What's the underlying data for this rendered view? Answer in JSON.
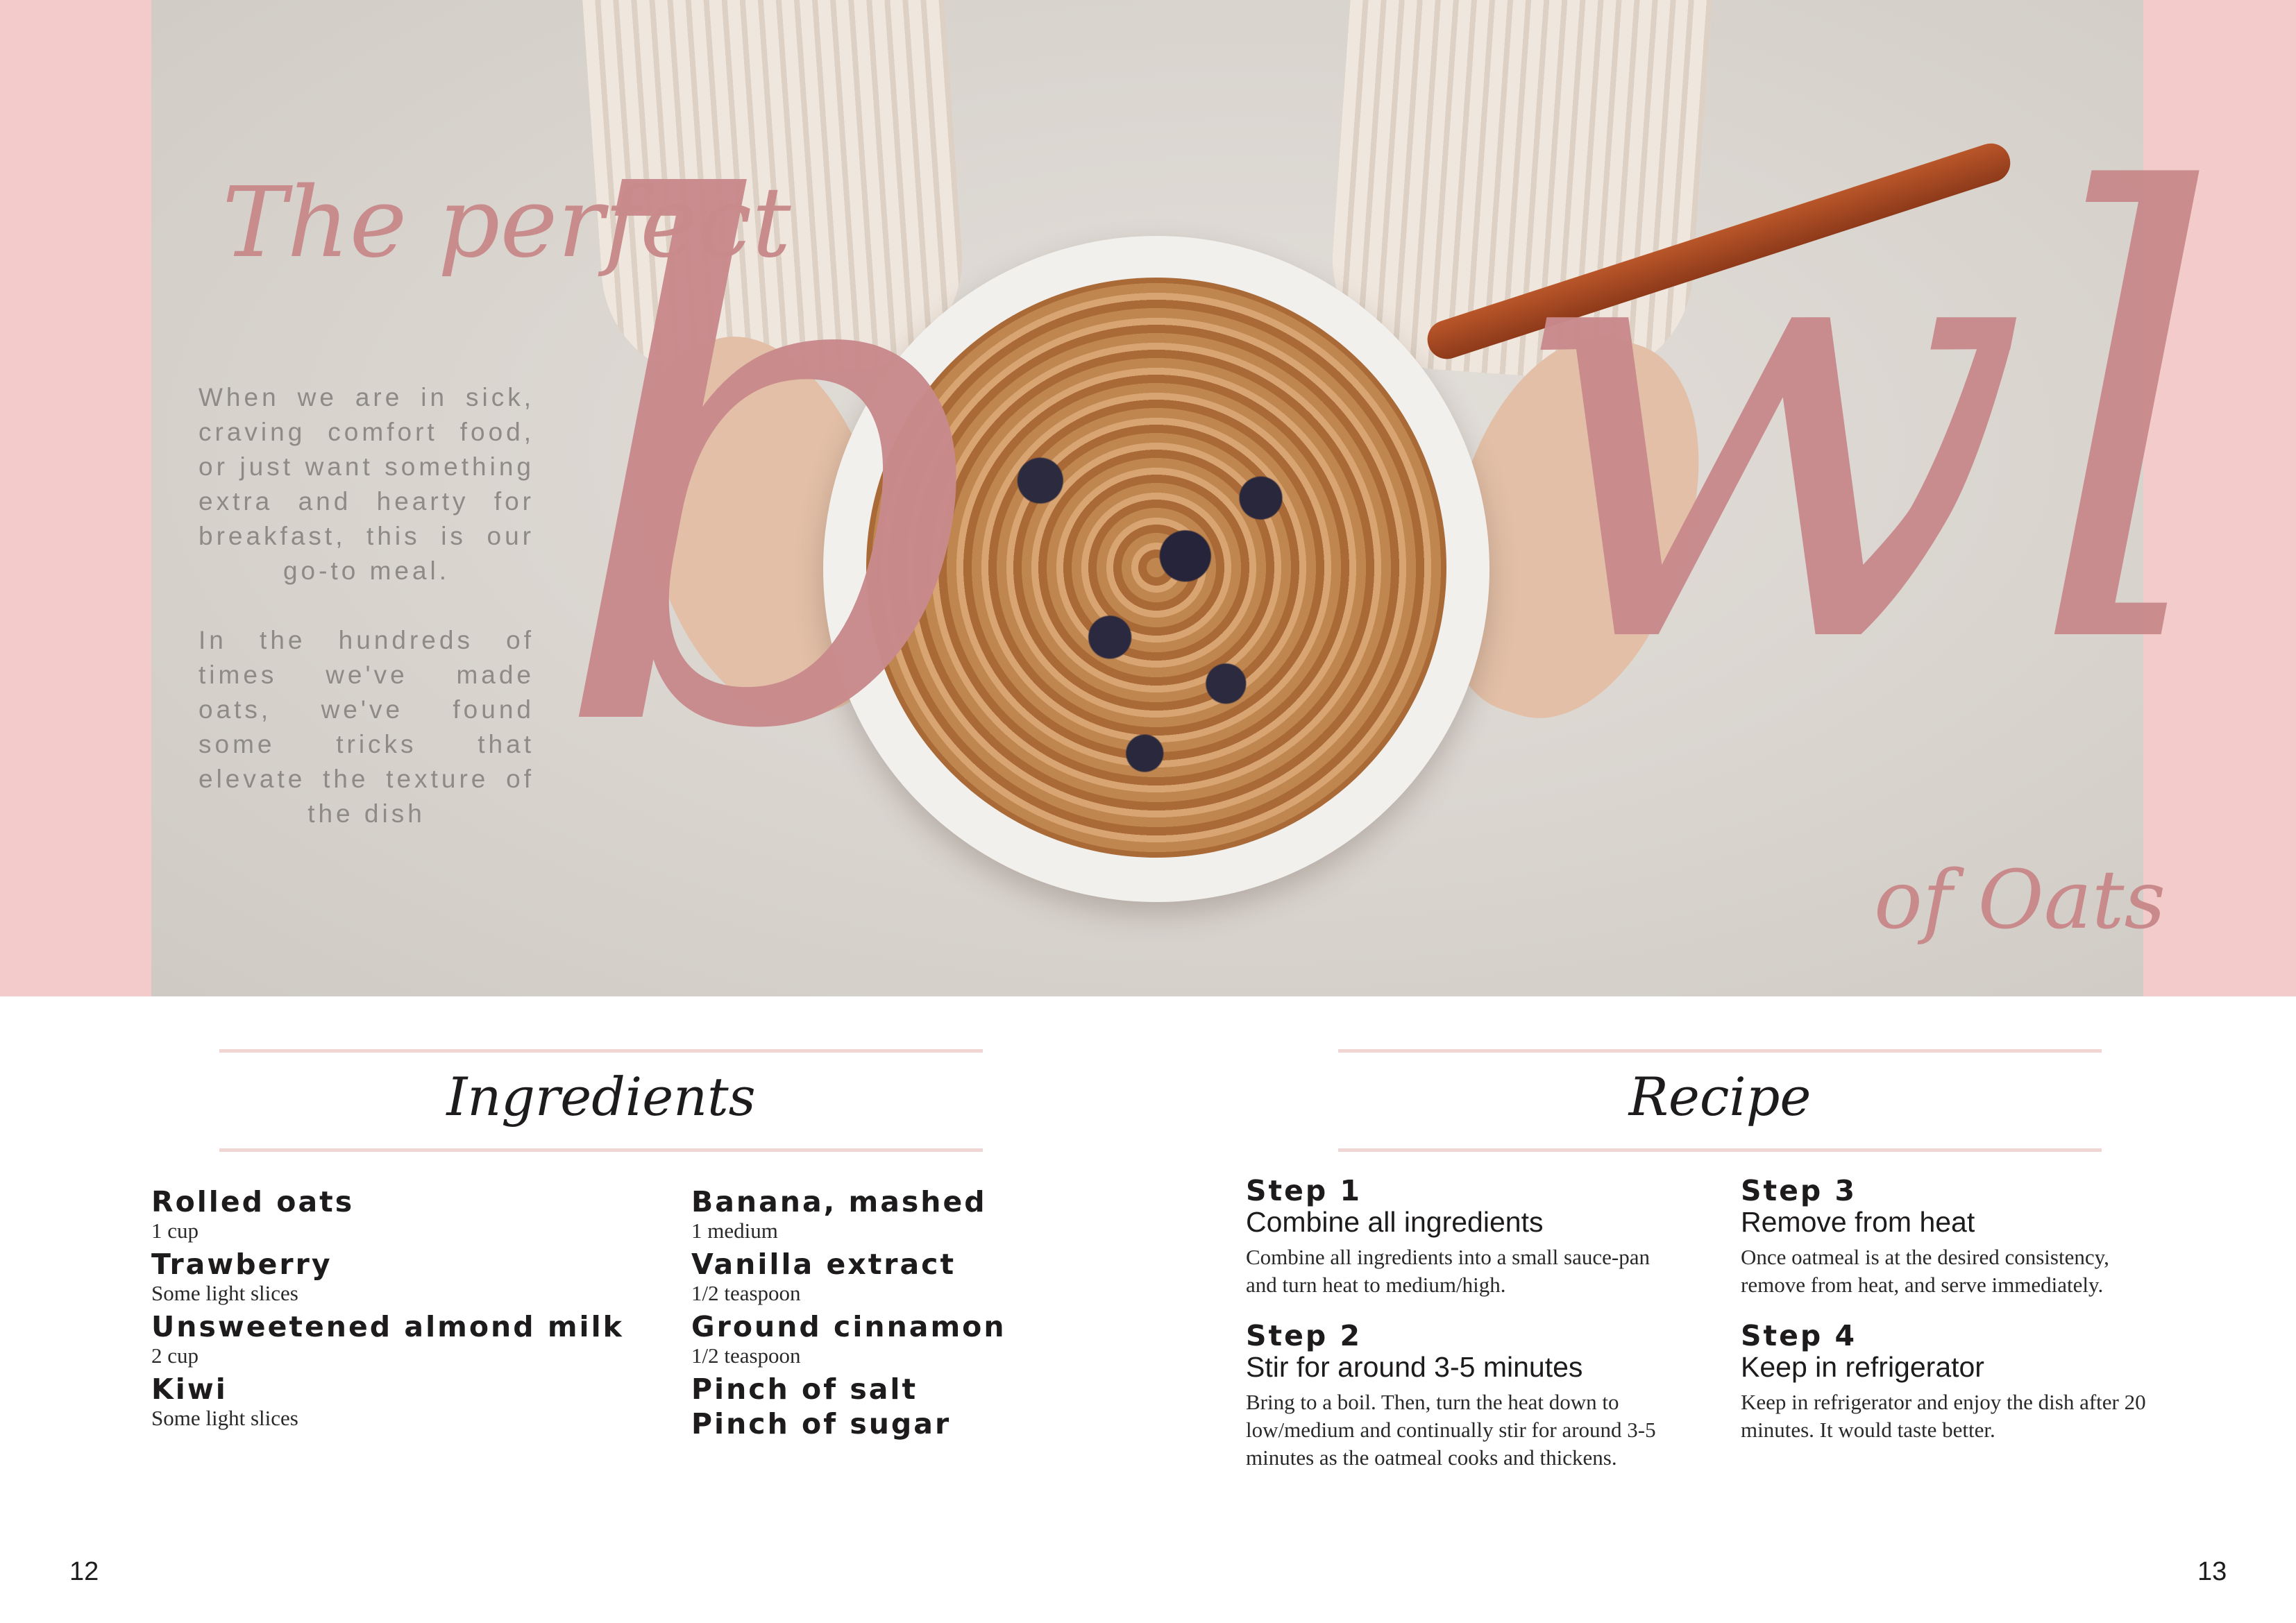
{
  "hero": {
    "title_top": "The perfect",
    "title_big_left": "b",
    "title_big_right": "wl",
    "title_bottom": "of Oats",
    "intro_paragraph_1": "When we are in sick, craving comfort food, or just want something extra and hearty for breakfast, this is our go-to meal.",
    "intro_paragraph_2": "In the hundreds of times we've made oats, we've found some tricks that elevate the texture of the dish"
  },
  "ingredients": {
    "heading": "Ingredients",
    "column_1": [
      {
        "name": "Rolled oats",
        "amount": "1 cup"
      },
      {
        "name": "Trawberry",
        "amount": "Some light slices"
      },
      {
        "name": "Unsweetened almond milk",
        "amount": "2 cup"
      },
      {
        "name": "Kiwi",
        "amount": "Some light slices"
      }
    ],
    "column_2": [
      {
        "name": "Banana, mashed",
        "amount": "1 medium"
      },
      {
        "name": "Vanilla extract",
        "amount": "1/2 teaspoon"
      },
      {
        "name": "Ground cinnamon",
        "amount": "1/2 teaspoon"
      },
      {
        "name": "Pinch of salt",
        "amount": ""
      },
      {
        "name": "Pinch of sugar",
        "amount": ""
      }
    ]
  },
  "recipe": {
    "heading": "Recipe",
    "steps": [
      {
        "num": "Step 1",
        "title": "Combine all ingredients",
        "body": "Combine all ingredients into a small sauce-pan and turn heat to medium/high."
      },
      {
        "num": "Step 2",
        "title": "Stir for around 3-5 minutes",
        "body": "Bring to a boil. Then, turn the heat down to low/medium and continually stir for around 3-5 minutes as the oatmeal cooks and thickens."
      },
      {
        "num": "Step 3",
        "title": "Remove from heat",
        "body": "Once oatmeal is at the desired consistency, remove from heat, and serve immediately."
      },
      {
        "num": "Step 4",
        "title": "Keep in refrigerator",
        "body": "Keep in refrigerator and enjoy the dish after 20 minutes. It would taste better."
      }
    ]
  },
  "pages": {
    "left": "12",
    "right": "13"
  },
  "colors": {
    "accent_pink": "#f2cbca",
    "title_pink": "#c98a8c",
    "text_dark": "#1d1b1b"
  }
}
